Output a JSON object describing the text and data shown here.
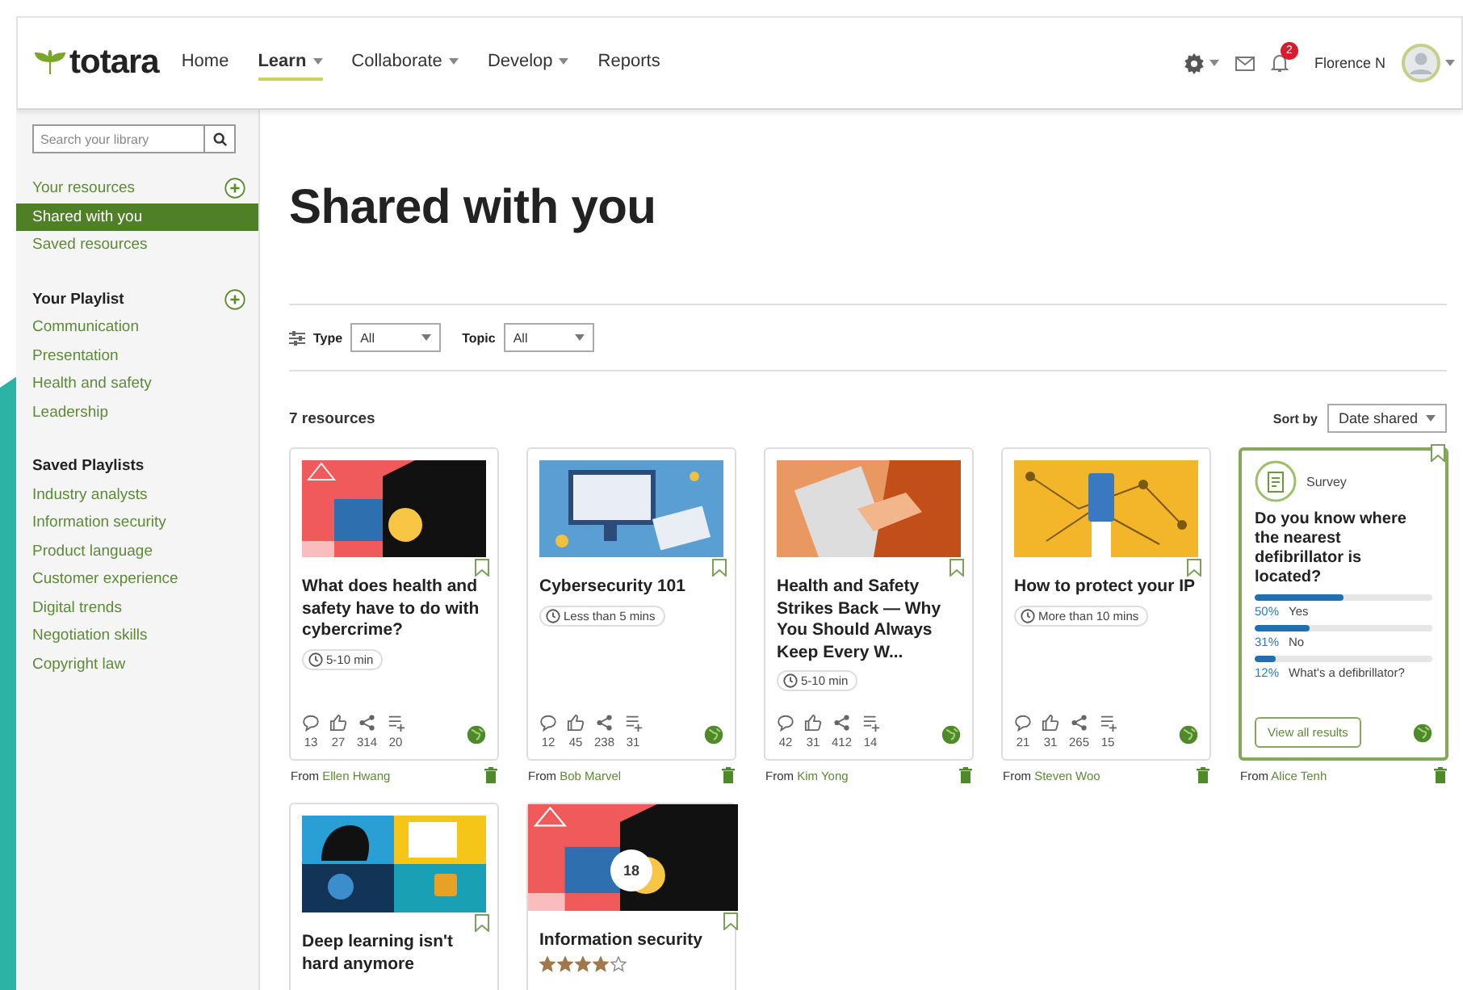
{
  "header": {
    "logo": "totara",
    "nav": [
      {
        "label": "Home",
        "selected": false,
        "menu": false
      },
      {
        "label": "Learn",
        "selected": true,
        "menu": true
      },
      {
        "label": "Collaborate",
        "selected": false,
        "menu": true
      },
      {
        "label": "Develop",
        "selected": false,
        "menu": true
      },
      {
        "label": "Reports",
        "selected": false,
        "menu": false
      }
    ],
    "notifications": "2",
    "user": "Florence N"
  },
  "sidebar": {
    "search": {
      "placeholder": "Search your library"
    },
    "library": [
      {
        "label": "Your resources",
        "selected": false,
        "add": true
      },
      {
        "label": "Shared with you",
        "selected": true,
        "add": false
      },
      {
        "label": "Saved resources",
        "selected": false,
        "add": false
      }
    ],
    "sections": [
      {
        "title": "Your Playlist",
        "add": true,
        "items": [
          {
            "label": "Communication",
            "selected": false
          },
          {
            "label": "Presentation",
            "selected": false
          },
          {
            "label": "Health and safety",
            "selected": false
          },
          {
            "label": "Leadership",
            "selected": false
          }
        ]
      },
      {
        "title": "Saved Playlists",
        "add": false,
        "items": [
          {
            "label": "Industry analysts",
            "selected": false
          },
          {
            "label": "Information security",
            "selected": false
          },
          {
            "label": "Product language",
            "selected": false
          },
          {
            "label": "Customer experience",
            "selected": false
          },
          {
            "label": "Digital trends",
            "selected": false
          },
          {
            "label": "Negotiation skills",
            "selected": false
          },
          {
            "label": "Copyright law",
            "selected": false
          }
        ]
      }
    ]
  },
  "page_title": "Shared with you",
  "filters": [
    {
      "label": "Type",
      "value": "All"
    },
    {
      "label": "Topic",
      "value": "All"
    }
  ],
  "count": "7 resources",
  "sort": {
    "label": "Sort by",
    "value": "Date shared"
  },
  "cards": [
    {
      "kind": "resource",
      "title": "What does health and safety have to do with cybercrime?",
      "duration": "5-10 min",
      "stats": [
        {
          "kind": "comments",
          "count": "13"
        },
        {
          "kind": "likes",
          "count": "27"
        },
        {
          "kind": "shares",
          "count": "314"
        },
        {
          "kind": "playlists",
          "count": "20"
        }
      ],
      "from_label": "From",
      "shared_by": "Ellen Hwang"
    },
    {
      "kind": "resource",
      "title": "Cybersecurity 101",
      "duration": "Less than 5 mins",
      "stats": [
        {
          "kind": "comments",
          "count": "12"
        },
        {
          "kind": "likes",
          "count": "45"
        },
        {
          "kind": "shares",
          "count": "238"
        },
        {
          "kind": "playlists",
          "count": "31"
        }
      ],
      "from_label": "From",
      "shared_by": "Bob Marvel"
    },
    {
      "kind": "resource",
      "title": "Health and Safety Strikes Back — Why You Should Always Keep Every W...",
      "duration": "5-10 min",
      "stats": [
        {
          "kind": "comments",
          "count": "42"
        },
        {
          "kind": "likes",
          "count": "31"
        },
        {
          "kind": "shares",
          "count": "412"
        },
        {
          "kind": "playlists",
          "count": "14"
        }
      ],
      "from_label": "From",
      "shared_by": "Kim Yong"
    },
    {
      "kind": "resource",
      "title": "How to protect your IP",
      "duration": "More than 10 mins",
      "stats": [
        {
          "kind": "comments",
          "count": "21"
        },
        {
          "kind": "likes",
          "count": "31"
        },
        {
          "kind": "shares",
          "count": "265"
        },
        {
          "kind": "playlists",
          "count": "15"
        }
      ],
      "from_label": "From",
      "shared_by": "Steven Woo"
    },
    {
      "kind": "survey",
      "label": "Survey",
      "title": "Do you know where the nearest defibrillator is located?",
      "options": [
        {
          "percent": "50%",
          "label": "Yes",
          "level": 0.5
        },
        {
          "percent": "31%",
          "label": "No",
          "level": 0.31
        },
        {
          "percent": "12%",
          "label": "What's a defibrillator?",
          "level": 0.12
        }
      ],
      "button": "View all results",
      "from_label": "From",
      "shared_by": "Alice Tenh"
    },
    {
      "kind": "resource",
      "title": "Deep learning isn't hard anymore"
    },
    {
      "kind": "playlist",
      "title": "Information security",
      "badge": "18",
      "stars": 4
    }
  ]
}
